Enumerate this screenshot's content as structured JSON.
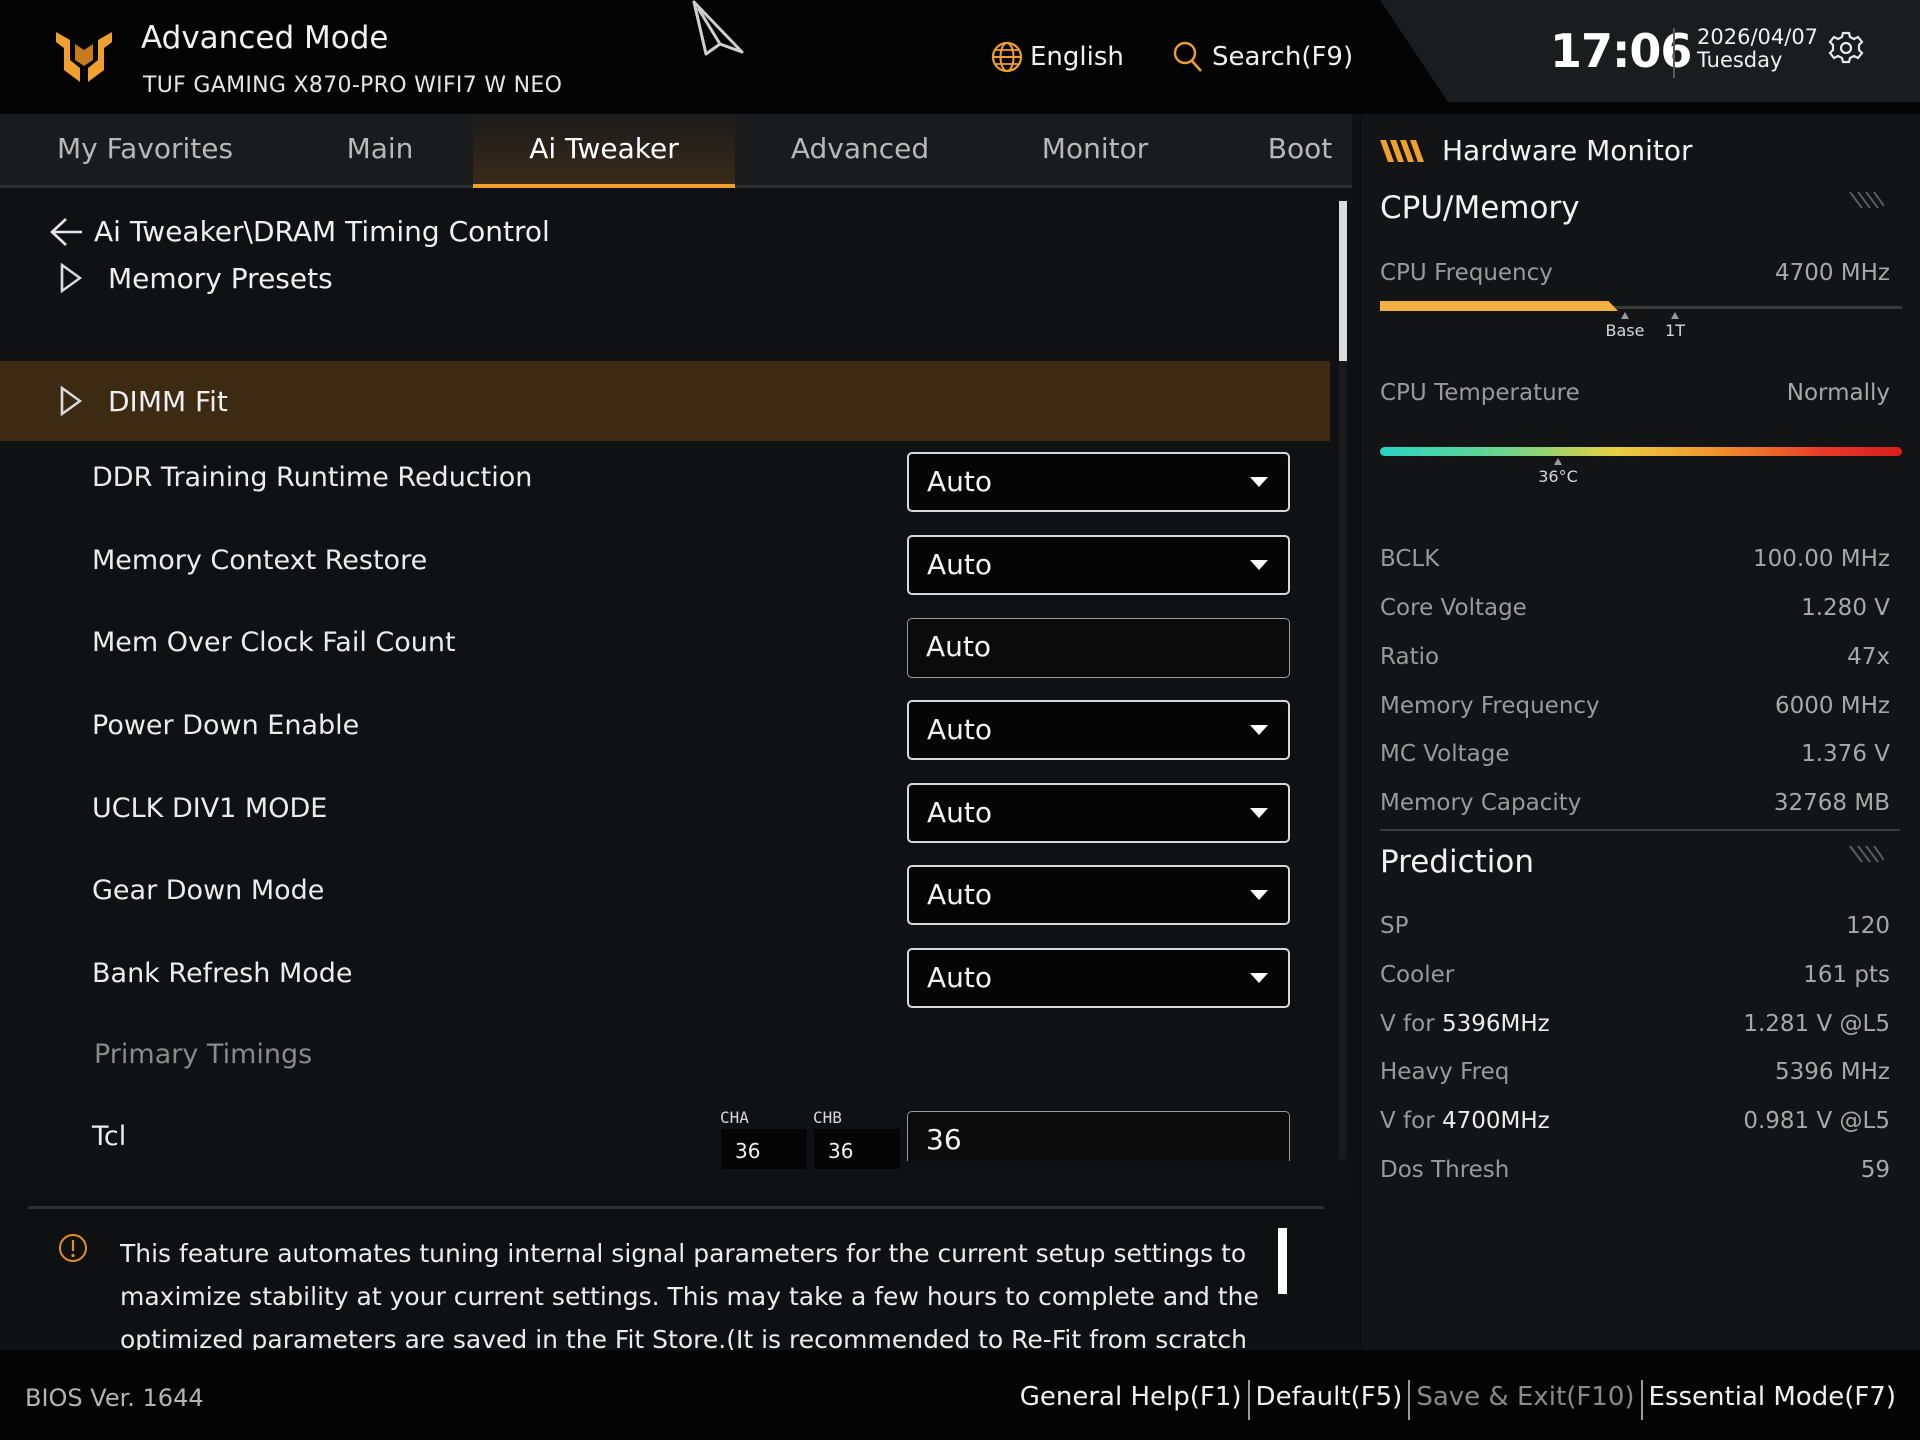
{
  "header": {
    "title": "Advanced Mode",
    "model": "TUF GAMING X870-PRO WIFI7 W NEO",
    "language": "English",
    "search": "Search(F9)",
    "time": "17:06",
    "date": "2026/04/07",
    "weekday": "Tuesday"
  },
  "tabs": [
    "My Favorites",
    "Main",
    "Ai Tweaker",
    "Advanced",
    "Monitor",
    "Boot"
  ],
  "active_tab": "Ai Tweaker",
  "breadcrumb": "Ai Tweaker\\DRAM Timing Control",
  "groups": {
    "memory_presets": "Memory Presets",
    "dimm_fit": "DIMM Fit"
  },
  "settings": [
    {
      "label": "DDR Training Runtime Reduction",
      "value": "Auto"
    },
    {
      "label": "Memory Context Restore",
      "value": "Auto"
    },
    {
      "label": "Mem Over Clock Fail Count",
      "value": "Auto"
    },
    {
      "label": "Power Down Enable",
      "value": "Auto"
    },
    {
      "label": "UCLK DIV1 MODE",
      "value": "Auto"
    },
    {
      "label": "Gear Down Mode",
      "value": "Auto"
    },
    {
      "label": "Bank Refresh Mode",
      "value": "Auto"
    }
  ],
  "primary_timings": {
    "section": "Primary Timings",
    "tcl_label": "Tcl",
    "cha_label": "CHA",
    "chb_label": "CHB",
    "cha_value": "36",
    "chb_value": "36",
    "tcl_value": "36"
  },
  "help": {
    "text": "This feature automates tuning internal signal parameters for the current setup settings to maximize stability at your current settings. This may take a few hours to complete and the optimized parameters are saved in the Fit Store.(It is recommended to Re-Fit from scratch when you change"
  },
  "hw_monitor": {
    "title": "Hardware Monitor",
    "cpu_memory": {
      "heading": "CPU/Memory",
      "cpu_frequency_label": "CPU Frequency",
      "cpu_frequency_value": "4700 MHz",
      "freq_fill_fraction": 0.455,
      "tick_base": "Base",
      "tick_1t": "1T",
      "cpu_temperature_label": "CPU Temperature",
      "cpu_temperature_value": "Normally",
      "temp_marker": "36°C",
      "temp_fraction": 0.34,
      "rows": [
        {
          "label": "BCLK",
          "value": "100.00 MHz"
        },
        {
          "label": "Core Voltage",
          "value": "1.280 V"
        },
        {
          "label": "Ratio",
          "value": "47x"
        },
        {
          "label": "Memory Frequency",
          "value": "6000 MHz"
        },
        {
          "label": "MC Voltage",
          "value": "1.376 V"
        },
        {
          "label": "Memory Capacity",
          "value": "32768 MB"
        }
      ]
    },
    "prediction": {
      "heading": "Prediction",
      "rows": [
        {
          "label": "SP",
          "value": "120"
        },
        {
          "label": "Cooler",
          "value": "161 pts"
        },
        {
          "label": "V for",
          "label_strong": "5396MHz",
          "value": "1.281 V @L5"
        },
        {
          "label": "Heavy Freq",
          "value": "5396 MHz"
        },
        {
          "label": "V for",
          "label_strong": "4700MHz",
          "value": "0.981 V @L5"
        },
        {
          "label": "Dos Thresh",
          "value": "59"
        }
      ]
    }
  },
  "footer": {
    "bios_version": "BIOS Ver. 1644",
    "general_help": "General Help(F1)",
    "default": "Default(F5)",
    "save_exit": "Save & Exit(F10)",
    "essential_mode": "Essential Mode(F7)"
  },
  "colors": {
    "accent": "#f2a02c",
    "selected_row": "#3d2a13"
  }
}
